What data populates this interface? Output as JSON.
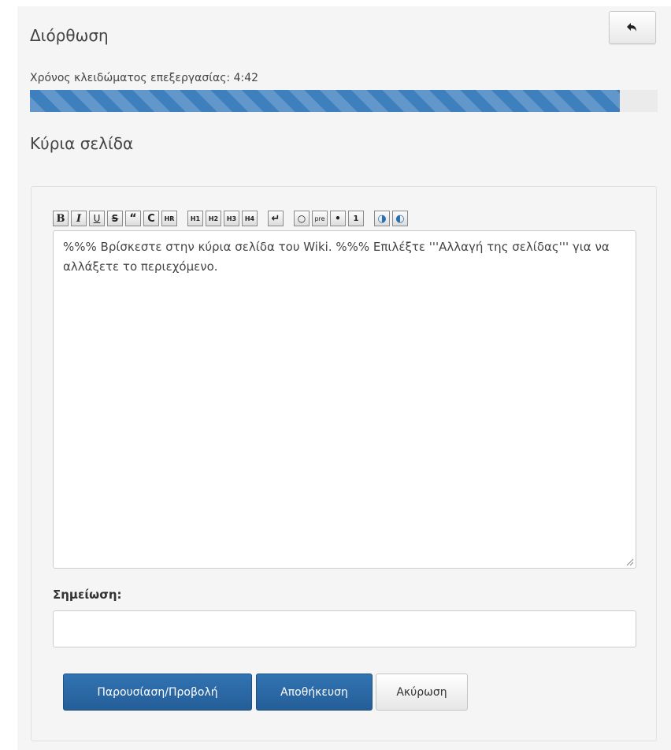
{
  "header": {
    "title": "Διόρθωση",
    "back_icon": "undo-arrow-icon"
  },
  "lock": {
    "label": "Χρόνος κλειδώματος επεξεργασίας: 4:42",
    "progress": 0.94,
    "color": "#3e80be"
  },
  "section": {
    "title": "Κύρια σελίδα"
  },
  "toolbar": {
    "buttons": [
      {
        "name": "bold-icon",
        "glyph": "B"
      },
      {
        "name": "italic-icon",
        "glyph": "I"
      },
      {
        "name": "underline-icon",
        "glyph": "U"
      },
      {
        "name": "strikethrough-icon",
        "glyph": "S"
      },
      {
        "name": "quote-icon",
        "glyph": "“"
      },
      {
        "name": "code-icon",
        "glyph": "C"
      },
      {
        "name": "horizontal-rule-icon",
        "glyph": "HR"
      },
      {
        "name": "heading1-icon",
        "glyph": "H1"
      },
      {
        "name": "heading2-icon",
        "glyph": "H2"
      },
      {
        "name": "heading3-icon",
        "glyph": "H3"
      },
      {
        "name": "heading4-icon",
        "glyph": "H4"
      },
      {
        "name": "line-break-icon",
        "glyph": "↵"
      },
      {
        "name": "comment-icon",
        "glyph": "○"
      },
      {
        "name": "preformatted-icon",
        "glyph": "pre"
      },
      {
        "name": "bullet-list-icon",
        "glyph": "•"
      },
      {
        "name": "numbered-list-icon",
        "glyph": "1"
      },
      {
        "name": "internal-link-icon",
        "glyph": "◑"
      },
      {
        "name": "external-link-icon",
        "glyph": "◐"
      }
    ]
  },
  "editor": {
    "content": "%%% Βρίσκεστε στην κύρια σελίδα του Wiki.  %%% Επιλέξτε '''Αλλαγή της σελίδας''' για να αλλάξετε το περιεχόμενο."
  },
  "note": {
    "label": "Σημείωση:",
    "value": ""
  },
  "actions": {
    "preview": "Παρουσίαση/Προβολή",
    "save": "Αποθήκευση",
    "cancel": "Ακύρωση"
  }
}
